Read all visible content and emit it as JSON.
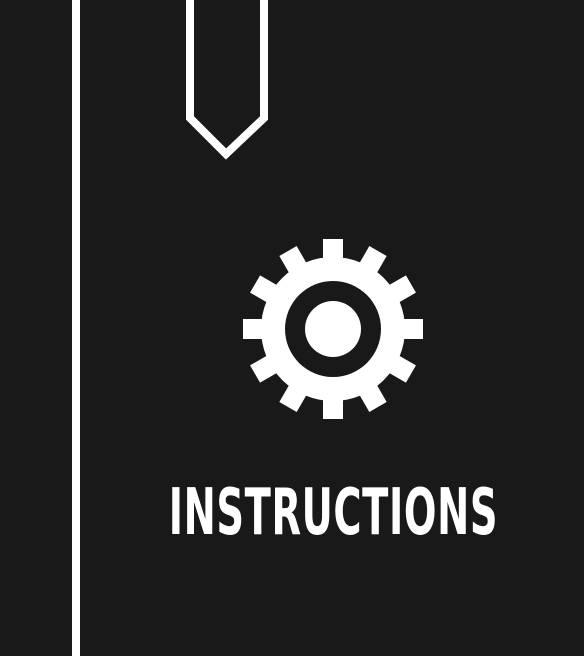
{
  "cover": {
    "title": "INSTRUCTIONS",
    "icon": "gear-icon",
    "colors": {
      "background": "#191919",
      "foreground": "#ffffff"
    }
  }
}
